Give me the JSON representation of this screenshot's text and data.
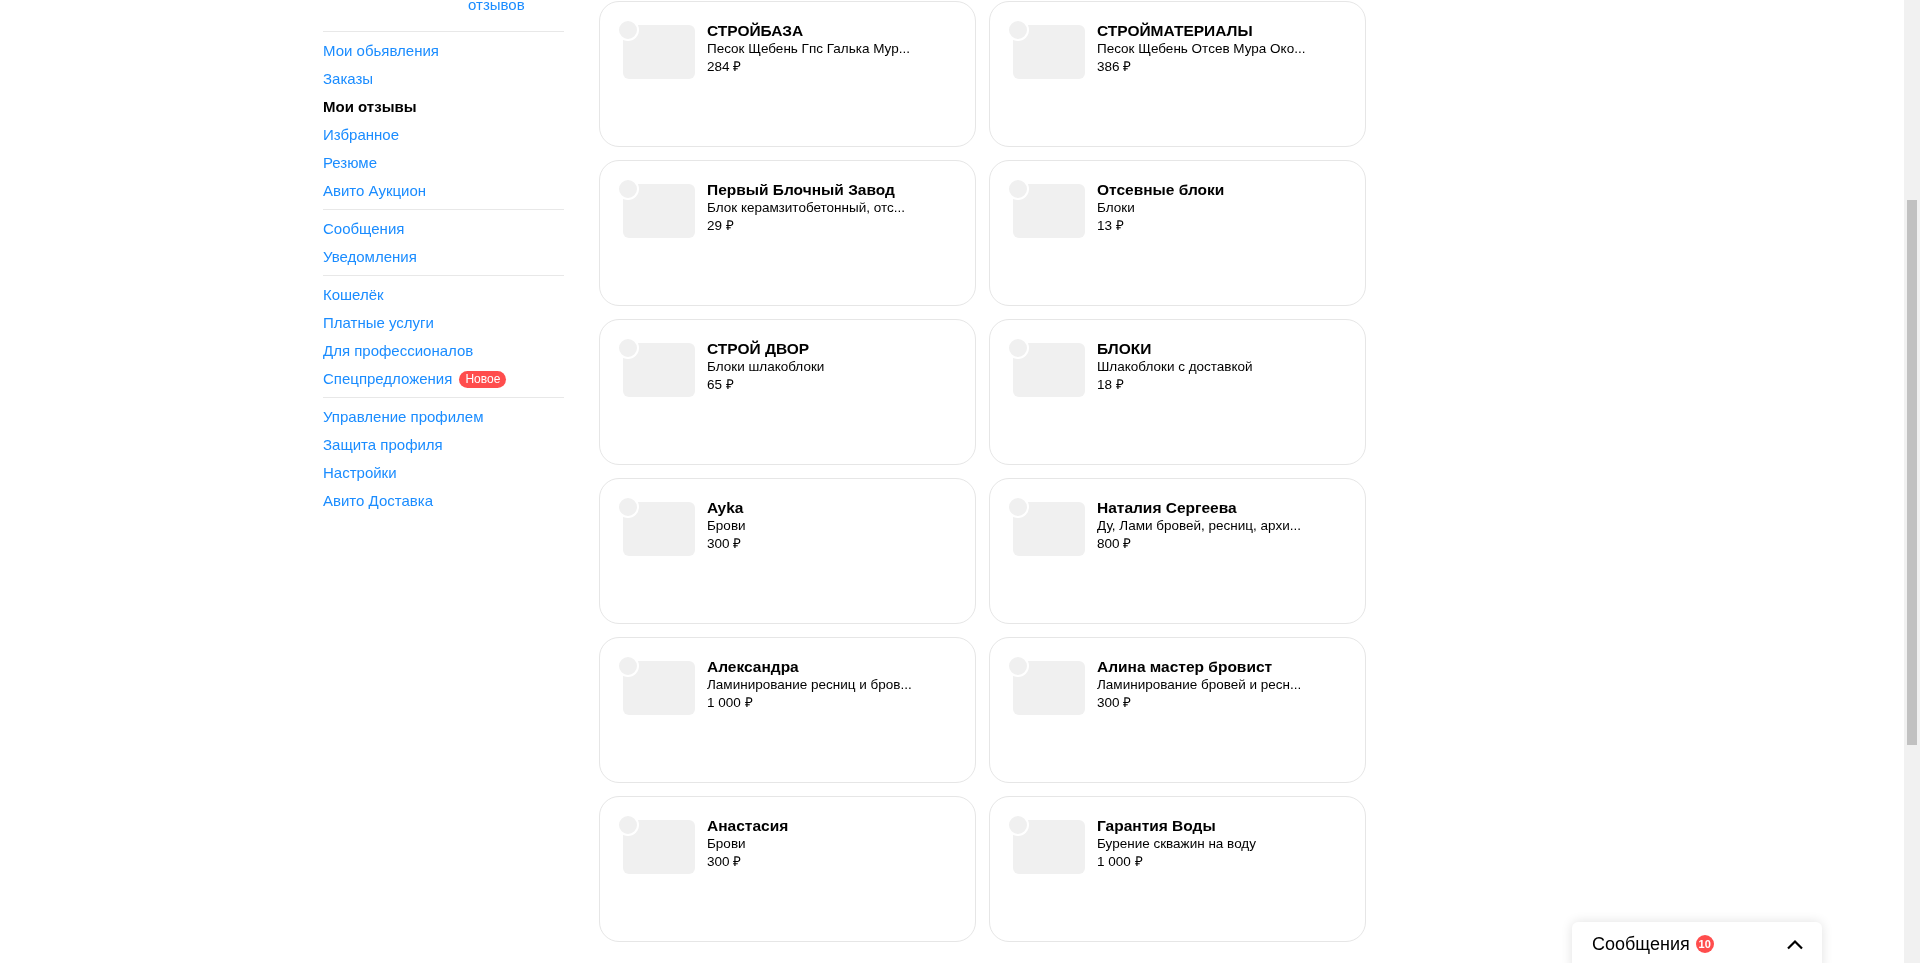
{
  "sidebar": {
    "top_link": "отзывов",
    "groups": [
      {
        "items": [
          {
            "label": "Мои обьявления",
            "selected": false
          },
          {
            "label": "Заказы",
            "selected": false
          },
          {
            "label": "Мои отзывы",
            "selected": true
          },
          {
            "label": "Избранное",
            "selected": false
          },
          {
            "label": "Резюме",
            "selected": false
          },
          {
            "label": "Авито Аукцион",
            "selected": false
          }
        ]
      },
      {
        "items": [
          {
            "label": "Сообщения",
            "selected": false
          },
          {
            "label": "Уведомления",
            "selected": false
          }
        ]
      },
      {
        "items": [
          {
            "label": "Кошелёк",
            "selected": false
          },
          {
            "label": "Платные услуги",
            "selected": false
          },
          {
            "label": "Для профессионалов",
            "selected": false
          },
          {
            "label": "Спецпредложения",
            "selected": false,
            "badge": "Новое"
          }
        ]
      },
      {
        "items": [
          {
            "label": "Управление профилем",
            "selected": false
          },
          {
            "label": "Защита профиля",
            "selected": false
          },
          {
            "label": "Настройки",
            "selected": false
          },
          {
            "label": "Авито Доставка",
            "selected": false
          }
        ]
      }
    ]
  },
  "cards": [
    {
      "title": "СТРОЙБАЗА",
      "subtitle": "Песок Щебень Гпс Галька Мур...",
      "price": "284 ₽"
    },
    {
      "title": "СТРОЙМАТЕРИАЛЫ",
      "subtitle": "Песок Щебень Отсев Мура Око...",
      "price": "386 ₽"
    },
    {
      "title": "Первый Блочный Завод",
      "subtitle": "Блок керамзитобетонный, отс...",
      "price": "29 ₽"
    },
    {
      "title": "Отсевные блоки",
      "subtitle": "Блоки",
      "price": "13 ₽"
    },
    {
      "title": "СТРОЙ ДВОР",
      "subtitle": "Блоки шлакоблоки",
      "price": "65 ₽"
    },
    {
      "title": "БЛОКИ",
      "subtitle": "Шлакоблоки с доставкой",
      "price": "18 ₽"
    },
    {
      "title": "Ayka",
      "subtitle": "Брови",
      "price": "300 ₽"
    },
    {
      "title": "Наталия Сергеева",
      "subtitle": "Ду, Лами бровей, ресниц, архи...",
      "price": "800 ₽"
    },
    {
      "title": "Александра",
      "subtitle": "Ламинирование ресниц и бров...",
      "price": "1 000 ₽"
    },
    {
      "title": "Алина мастер бровист",
      "subtitle": "Ламинирование бровей и ресн...",
      "price": "300 ₽"
    },
    {
      "title": "Анастасия",
      "subtitle": "Брови",
      "price": "300 ₽"
    },
    {
      "title": "Гарантия Воды",
      "subtitle": "Бурение скважин на воду",
      "price": "1 000 ₽"
    }
  ],
  "messages_widget": {
    "label": "Сообщения",
    "count": "10"
  }
}
